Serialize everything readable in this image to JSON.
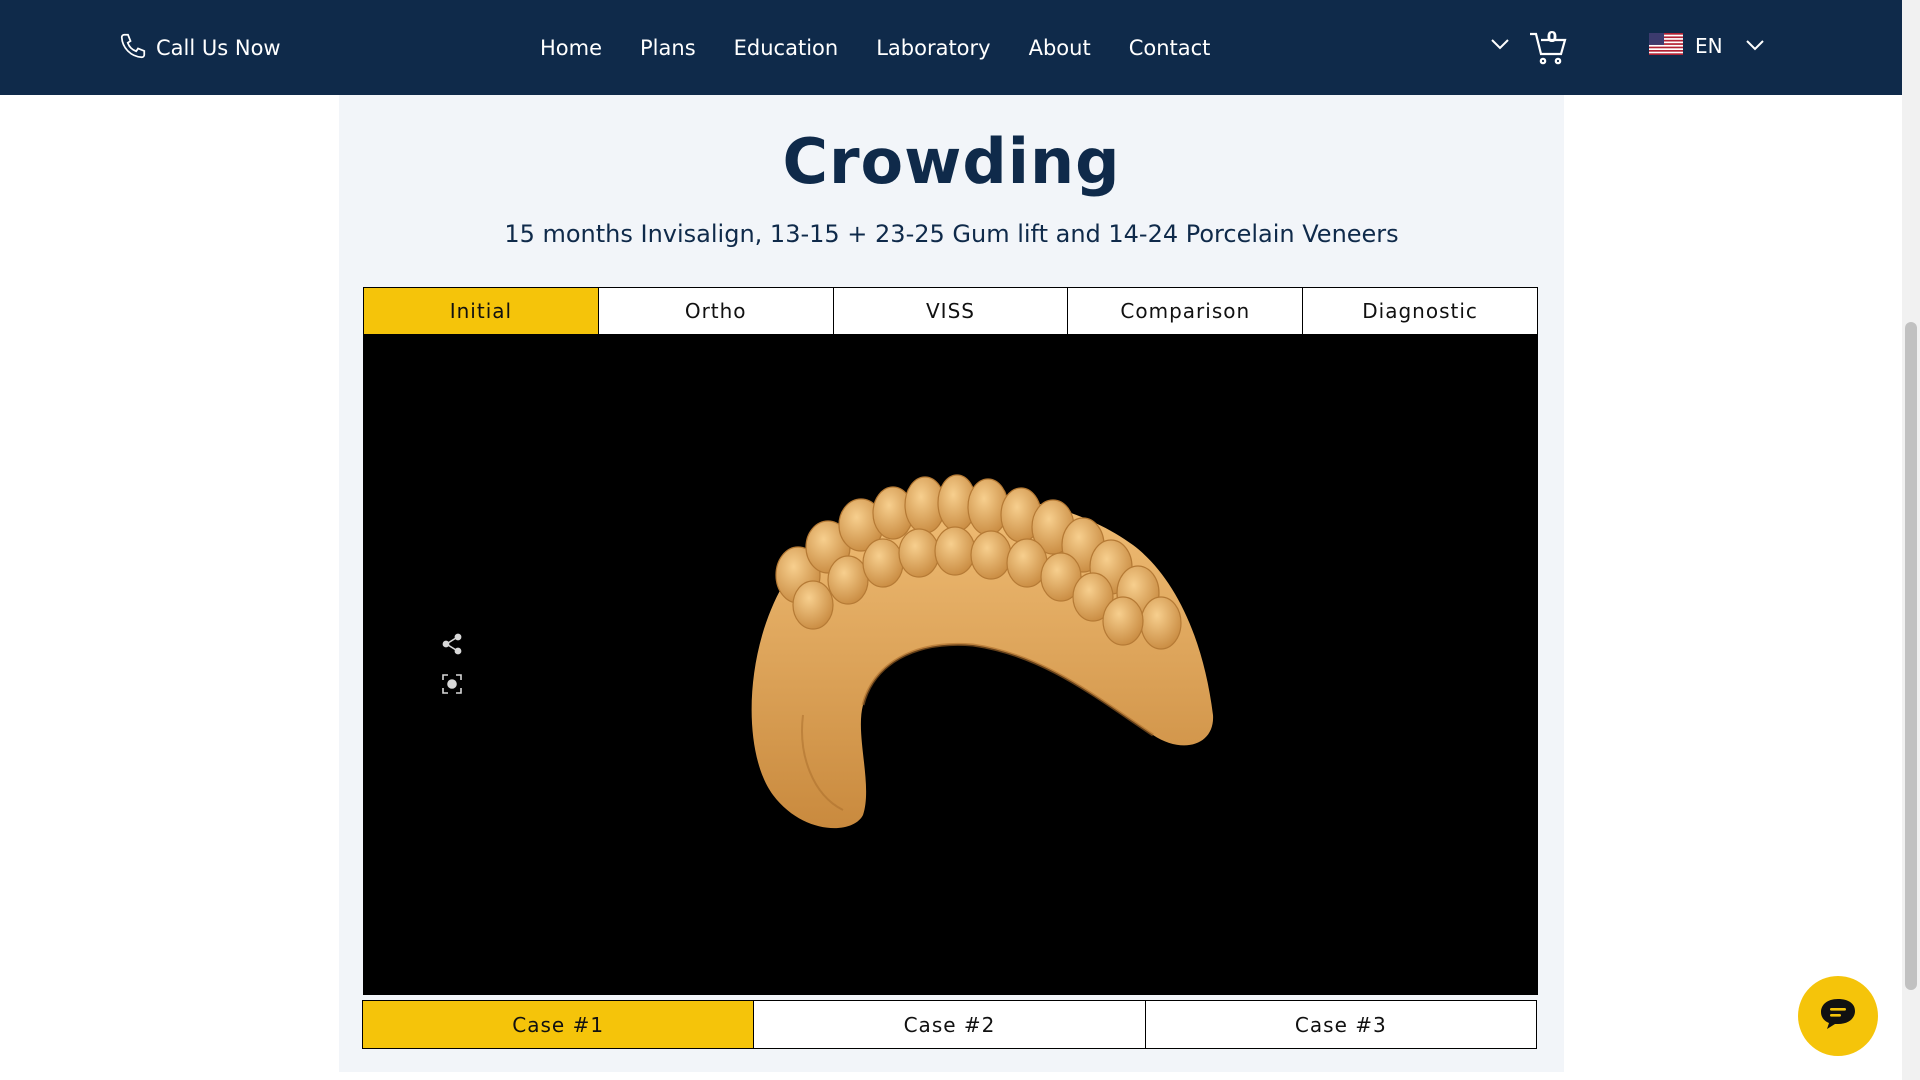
{
  "header": {
    "call_label": "Call Us Now",
    "nav": [
      "Home",
      "Plans",
      "Education",
      "Laboratory",
      "About",
      "Contact"
    ],
    "cart_count": "0",
    "language": "EN"
  },
  "case": {
    "title": "Crowding",
    "subtitle": "15 months Invisalign, 13-15 + 23-25 Gum lift and 14-24 Porcelain Veneers",
    "tabs": [
      "Initial",
      "Ortho",
      "VISS",
      "Comparison",
      "Diagnostic"
    ],
    "active_tab": "Initial",
    "cases": [
      "Case #1",
      "Case #2",
      "Case #3"
    ],
    "active_case": "Case #1"
  },
  "colors": {
    "header_bg": "#0f2a4a",
    "accent": "#f5c40a",
    "panel_bg": "#f2f5f9",
    "model": "#e0a35a"
  },
  "icons": {
    "call": "phone-icon",
    "more": "chevron-down-icon",
    "cart": "cart-icon",
    "flag": "us-flag-icon",
    "lang_more": "chevron-down-icon",
    "share": "share-icon",
    "focus": "focus-icon",
    "chat": "chat-icon"
  }
}
